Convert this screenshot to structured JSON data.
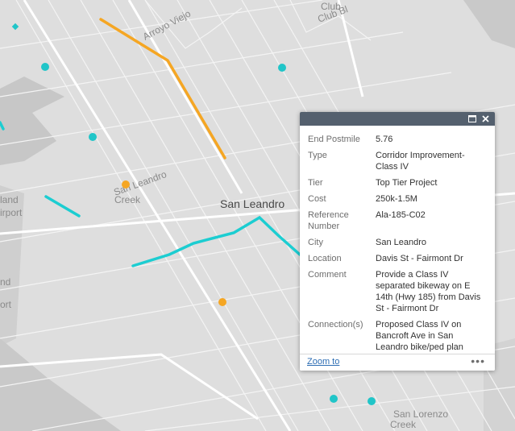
{
  "map": {
    "labels": {
      "san_leandro": "San Leandro",
      "arroyo_viejo": "Arroyo Viejo",
      "san_leandro_creek_1": "San Leandro",
      "san_leandro_creek_2": "Creek",
      "oakland_partial": "land",
      "airport_partial": "irport",
      "club_partial_1": "Club",
      "club_partial_2": "Club Bl",
      "san_lorenzo_1": "San Lorenzo",
      "san_lorenzo_2": "Creek",
      "edge_1": "nd",
      "edge_2": "ort"
    },
    "colors": {
      "land": "#dcdcdc",
      "water": "#c9c9c9",
      "roads": "#f5f5f5",
      "orange_route": "#f5a623",
      "cyan_route": "#1ccdd1",
      "cyan_point": "#20c5c8",
      "orange_point": "#f5a623"
    }
  },
  "popup": {
    "rows": [
      {
        "key": "End Postmile",
        "value": "5.76"
      },
      {
        "key": "Type",
        "value": "Corridor Improvement- Class IV"
      },
      {
        "key": "Tier",
        "value": "Top Tier Project"
      },
      {
        "key": "Cost",
        "value": "250k-1.5M"
      },
      {
        "key": "Reference Number",
        "value": "Ala-185-C02"
      },
      {
        "key": "City",
        "value": "San Leandro"
      },
      {
        "key": "Location",
        "value": "Davis St - Fairmont Dr"
      },
      {
        "key": "Comment",
        "value": "Provide a Class IV separated bikeway on E 14th (Hwy 185) from Davis St - Fairmont Dr"
      },
      {
        "key": "Connection(s)",
        "value": "Proposed Class IV on Bancroft Ave in San Leandro bike/ped plan"
      }
    ],
    "zoom_to": "Zoom to",
    "more": "•••",
    "icons": [
      "maximize-icon",
      "close-icon"
    ]
  }
}
